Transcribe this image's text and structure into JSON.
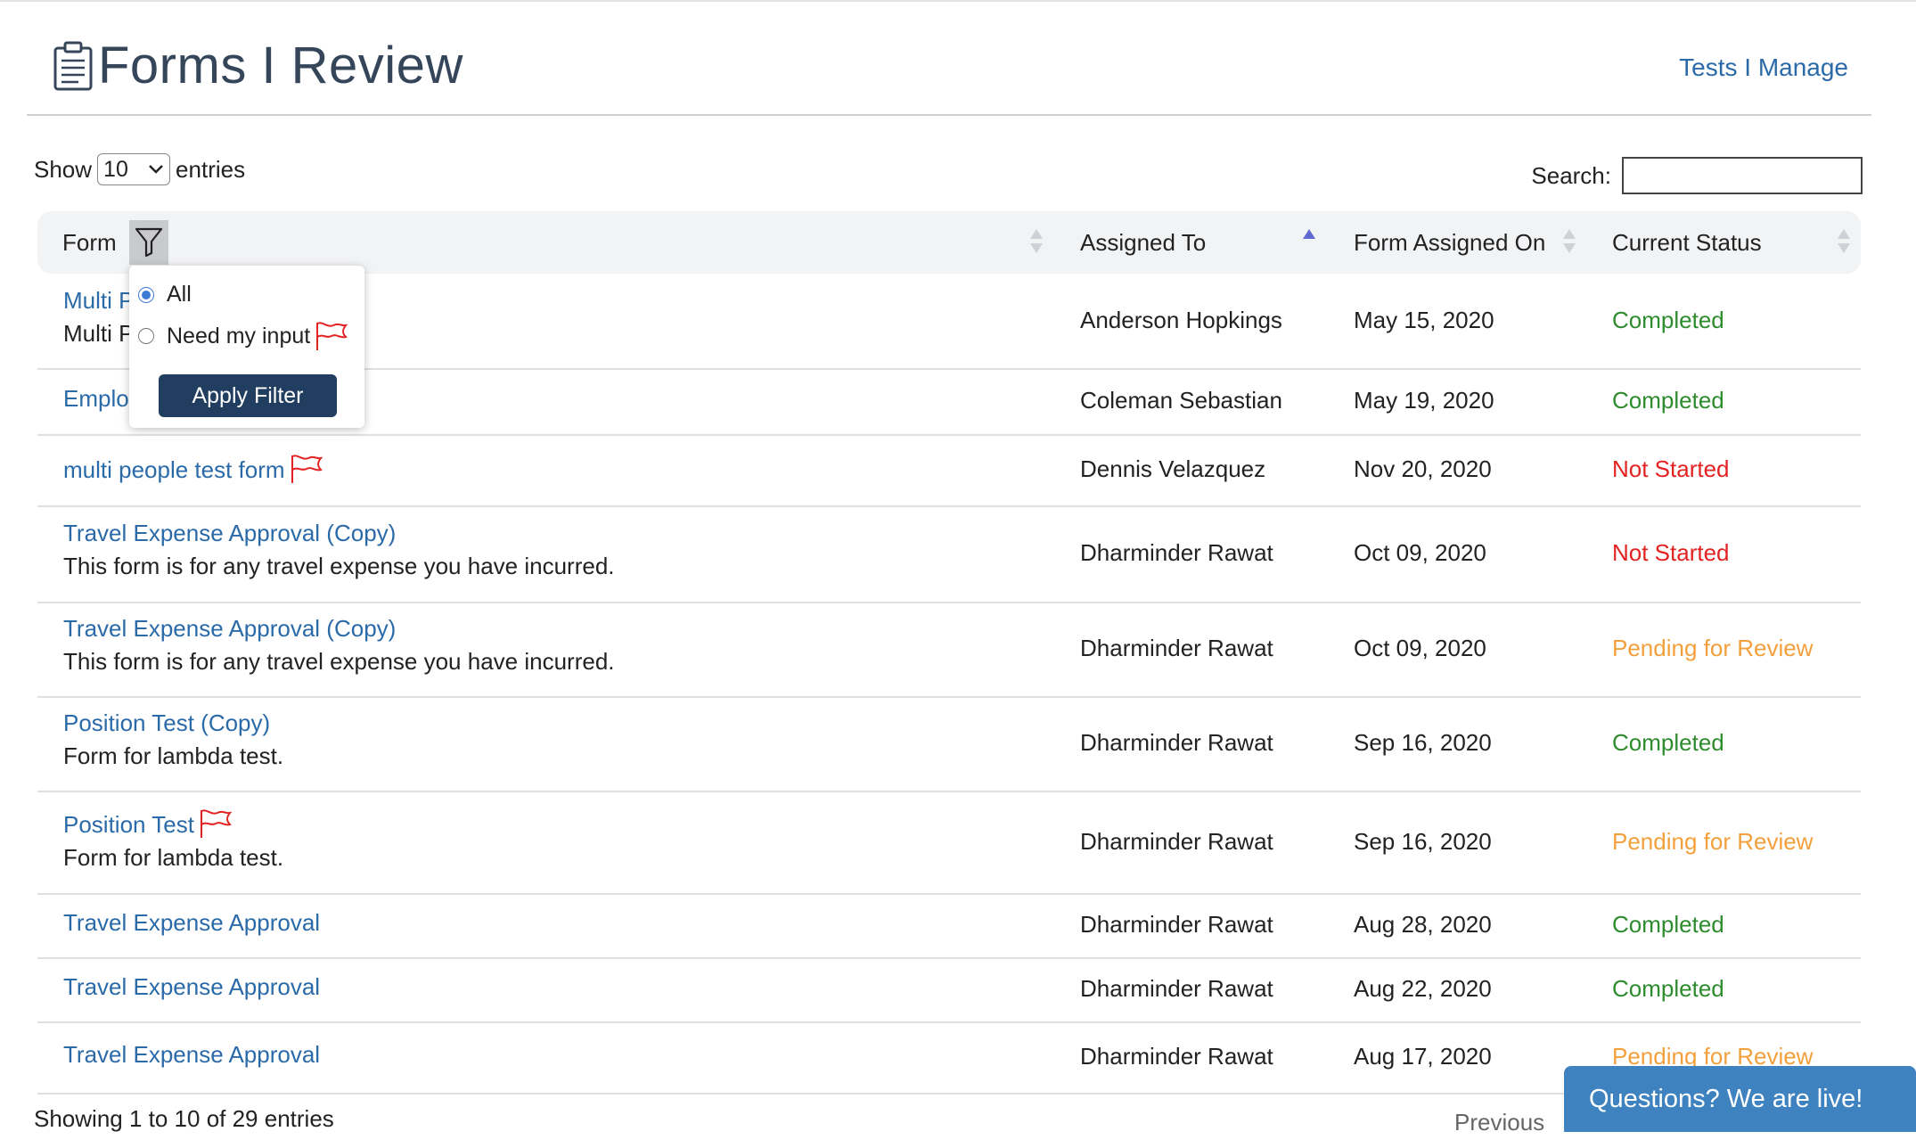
{
  "header": {
    "title": "Forms I Review",
    "icon": "clipboard-icon",
    "link_label": "Tests I Manage"
  },
  "controls": {
    "show_label": "Show",
    "entries_value": "10",
    "entries_label": "entries",
    "search_label": "Search:",
    "search_value": ""
  },
  "table": {
    "columns": [
      "Form",
      "Assigned To",
      "Form Assigned On",
      "Current Status"
    ],
    "sorted_column": "Assigned To",
    "sort_direction": "asc",
    "rows": [
      {
        "form": "Multi P",
        "desc": "Multi P",
        "flag": false,
        "assigned": "Anderson Hopkings",
        "date": "May 15, 2020",
        "status": "Completed"
      },
      {
        "form": "Employ",
        "desc": "",
        "flag": false,
        "assigned": "Coleman Sebastian",
        "date": "May 19, 2020",
        "status": "Completed"
      },
      {
        "form": "multi people test form",
        "desc": "",
        "flag": true,
        "assigned": "Dennis Velazquez",
        "date": "Nov 20, 2020",
        "status": "Not Started"
      },
      {
        "form": "Travel Expense Approval (Copy)",
        "desc": "This form is for any travel expense you have incurred.",
        "flag": false,
        "assigned": "Dharminder Rawat",
        "date": "Oct 09, 2020",
        "status": "Not Started"
      },
      {
        "form": "Travel Expense Approval (Copy)",
        "desc": "This form is for any travel expense you have incurred.",
        "flag": false,
        "assigned": "Dharminder Rawat",
        "date": "Oct 09, 2020",
        "status": "Pending for Review"
      },
      {
        "form": "Position Test (Copy)",
        "desc": "Form for lambda test.",
        "flag": false,
        "assigned": "Dharminder Rawat",
        "date": "Sep 16, 2020",
        "status": "Completed"
      },
      {
        "form": "Position Test",
        "desc": "Form for lambda test.",
        "flag": true,
        "assigned": "Dharminder Rawat",
        "date": "Sep 16, 2020",
        "status": "Pending for Review"
      },
      {
        "form": "Travel Expense Approval",
        "desc": "",
        "flag": false,
        "assigned": "Dharminder Rawat",
        "date": "Aug 28, 2020",
        "status": "Completed"
      },
      {
        "form": "Travel Expense Approval",
        "desc": "",
        "flag": false,
        "assigned": "Dharminder Rawat",
        "date": "Aug 22, 2020",
        "status": "Completed"
      },
      {
        "form": "Travel Expense Approval",
        "desc": "",
        "flag": false,
        "assigned": "Dharminder Rawat",
        "date": "Aug 17, 2020",
        "status": "Pending for Review"
      }
    ]
  },
  "filter_popup": {
    "options": [
      "All",
      "Need my input"
    ],
    "selected": "All",
    "apply_label": "Apply Filter"
  },
  "footer": {
    "info": "Showing 1 to 10 of 29 entries",
    "previous_label": "Previous"
  },
  "chat": {
    "label": "Questions? We are live!"
  },
  "colors": {
    "completed": "#2e8b2e",
    "not_started": "#e32222",
    "pending": "#f3a03c",
    "link": "#2b6aa8",
    "apply_button": "#213d5f",
    "chat_button": "#3e83c0"
  }
}
